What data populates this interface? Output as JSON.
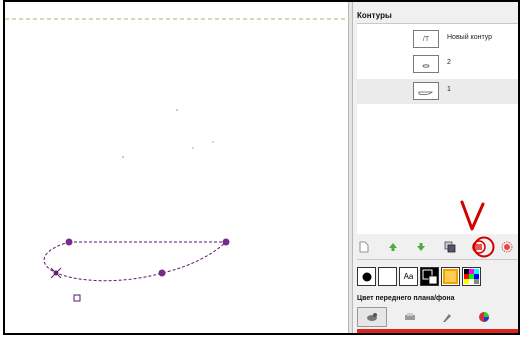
{
  "panel": {
    "title": "Контуры",
    "paths": [
      {
        "label": "Новый контур",
        "thumb": "/T"
      },
      {
        "label": "2"
      },
      {
        "label": "1",
        "selected": true
      }
    ]
  },
  "toolbar": {
    "icons": [
      "new-path-icon",
      "raise-path-icon",
      "lower-path-icon",
      "duplicate-path-icon",
      "path-to-selection-icon",
      "selection-to-path-icon"
    ]
  },
  "tabs": {
    "text_tab": "Aa"
  },
  "fg_bg": {
    "title": "Цвет переднего плана/фона"
  },
  "colors": {
    "path": "#5a1a6a",
    "guide": "#b8b060",
    "annotation": "#d40000"
  }
}
